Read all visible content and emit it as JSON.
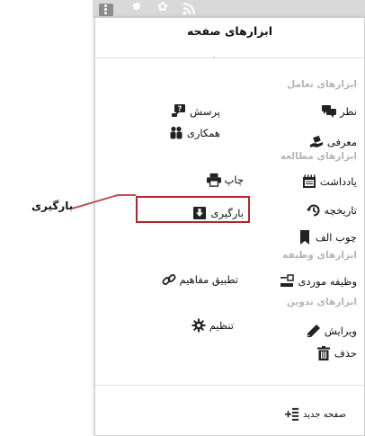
{
  "panel": {
    "title": "ابزارهای صفحه",
    "subtitle_mark": "،"
  },
  "sections": {
    "interaction": "ابزارهای تعامل",
    "study": "ابزارهای مطالعه",
    "task": "ابزارهای وظیفه",
    "edit": "ابزارهای تدوین"
  },
  "items": {
    "comment": "نظر",
    "ask": "پرسش",
    "introduce": "معرفی",
    "collaborate": "همکاری",
    "notes": "یادداشت",
    "print": "چاپ",
    "history": "تاریخچه",
    "download": "بارگیری",
    "bookmark": "چوب الف",
    "case_task": "وظیفه موردی",
    "concept_map": "تطبیق مفاهیم",
    "edit": "ویرایش",
    "settings": "تنظیم",
    "delete": "حذف",
    "new_page": "صفحه جدید"
  },
  "callout": {
    "label": "بارگیری",
    "color": "#b4262a"
  },
  "icons": {
    "menu": "menu-icon",
    "star": "star-icon",
    "gear": "gear-icon",
    "rss": "rss-icon",
    "comment": "comment-icon",
    "ask": "question-bubble-icon",
    "introduce": "share-hand-icon",
    "collaborate": "people-icon",
    "notes": "notebook-icon",
    "print": "printer-icon",
    "history": "history-clock-icon",
    "download": "download-icon",
    "bookmark": "bookmark-icon",
    "case_task": "task-list-icon",
    "concept_map": "link-icon",
    "edit": "pencil-icon",
    "settings": "gear-icon",
    "delete": "trash-icon",
    "new_page": "add-page-icon"
  }
}
